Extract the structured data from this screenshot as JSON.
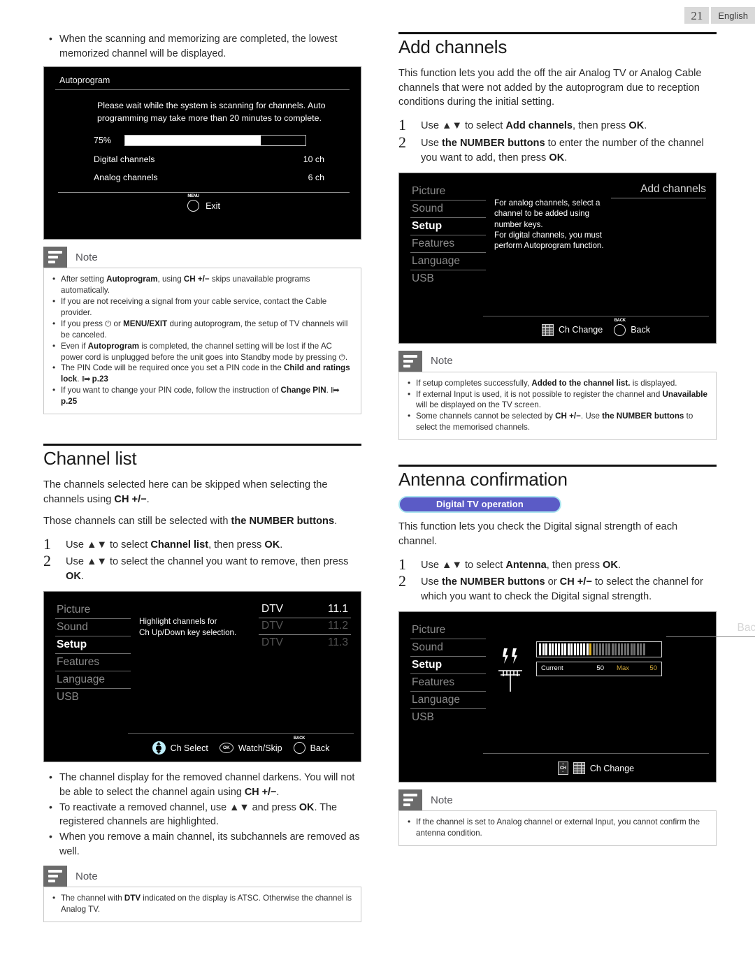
{
  "header": {
    "page_number": "21",
    "language": "English"
  },
  "left_column": {
    "intro_bullets": [
      "When the scanning and memorizing are completed, the lowest memorized channel will be displayed."
    ],
    "autoprogram_screen": {
      "title": "Autoprogram",
      "message": "Please wait while the system is scanning for channels. Auto programming may take more than 20 minutes to complete.",
      "progress_percent": "75%",
      "progress_value": 75,
      "rows": [
        {
          "label": "Digital channels",
          "value": "10 ch"
        },
        {
          "label": "Analog channels",
          "value": "6 ch"
        }
      ],
      "footer_button_cap": "MENU",
      "footer_button_label": "Exit"
    },
    "note1": {
      "label": "Note",
      "items": [
        "After setting <b>Autoprogram</b>, using <b>CH +/−</b> skips unavailable programs automatically.",
        "If you are not receiving a signal from your cable service, contact the Cable provider.",
        "If you press ⏻ or <b>MENU/EXIT</b> during autoprogram, the setup of TV channels will be canceled.",
        "Even if <b>Autoprogram</b> is completed, the channel setting will be lost if the AC power cord is unplugged before the unit goes into Standby mode by pressing ⏻.",
        "The PIN Code will be required once you set a PIN code in the <b>Child and ratings lock</b>. <span class='arrow-ref'>‖➡</span> <b>p.23</b>",
        "If you want to change your PIN code, follow the instruction of <b>Change PIN</b>. <span class='arrow-ref'>‖➡</span> <b>p.25</b>"
      ]
    },
    "channel_list_section": {
      "title": "Channel list",
      "paragraphs": [
        "The channels selected here can be skipped when selecting the channels using <b>CH +/−</b>.",
        "Those channels can still be selected with <b>the NUMBER buttons</b>."
      ],
      "steps": [
        {
          "num": "1",
          "text": "Use ▲▼ to select <b>Channel list</b>, then press <b>OK</b>."
        },
        {
          "num": "2",
          "text": "Use ▲▼ to select the channel you want to remove, then press <b>OK</b>."
        }
      ],
      "tv_menu": {
        "menu_items": [
          "Picture",
          "Sound",
          "Setup",
          "Features",
          "Language",
          "USB"
        ],
        "selected_item": "Setup",
        "middle_text": "Highlight channels for\nCh Up/Down key selection.",
        "channels": [
          {
            "type": "DTV",
            "number": "11.1",
            "state": "bright"
          },
          {
            "type": "DTV",
            "number": "11.2",
            "state": "dim"
          },
          {
            "type": "DTV",
            "number": "11.3",
            "state": "dim"
          }
        ],
        "footer": [
          {
            "icon": "dpad-icon",
            "label": "Ch Select"
          },
          {
            "icon": "ok-button-icon",
            "label": "Watch/Skip"
          },
          {
            "icon": "back-button-icon",
            "cap": "BACK",
            "label": "Back"
          }
        ]
      },
      "after_bullets": [
        "The channel display for the removed channel darkens. You will not be able to select the channel again using <b>CH +/−</b>.",
        "To reactivate a removed channel, use ▲▼ and press <b>OK</b>. The registered channels are highlighted.",
        "When you remove a main channel, its subchannels are removed as well."
      ],
      "note": {
        "label": "Note",
        "items": [
          "The channel with <b>DTV</b> indicated on the display is ATSC. Otherwise the channel is Analog TV."
        ]
      }
    }
  },
  "right_column": {
    "add_channels_section": {
      "title": "Add channels",
      "paragraph": "This function lets you add the off the air Analog TV or Analog Cable channels that were not added by the autoprogram due to reception conditions during the initial setting.",
      "steps": [
        {
          "num": "1",
          "text": "Use ▲▼ to select <b>Add channels</b>, then press <b>OK</b>."
        },
        {
          "num": "2",
          "text": "Use <b>the NUMBER buttons</b> to enter the number of the channel you want to add, then press <b>OK</b>."
        }
      ],
      "tv_menu": {
        "menu_items": [
          "Picture",
          "Sound",
          "Setup",
          "Features",
          "Language",
          "USB"
        ],
        "selected_item": "Setup",
        "middle_text": "For analog channels, select a channel to be added using number keys.\nFor digital channels, you must perform Autoprogram function.",
        "right_header": "Add channels",
        "footer": [
          {
            "icon": "keypad-icon",
            "label": "Ch Change"
          },
          {
            "icon": "back-button-icon",
            "cap": "BACK",
            "label": "Back"
          }
        ]
      },
      "note": {
        "label": "Note",
        "items": [
          "If setup completes successfully, <b>Added to the channel list.</b> is displayed.",
          "If external Input is used, it is not possible to register the channel and <b>Unavailable</b> will be displayed on the TV screen.",
          "Some channels cannot be selected by <b>CH +/−</b>. Use <b>the NUMBER buttons</b> to select the memorised channels."
        ]
      }
    },
    "antenna_section": {
      "title": "Antenna confirmation",
      "badge": "Digital TV operation",
      "badge_color": "#5b5bc6",
      "paragraph": "This function lets you check the Digital signal strength of each channel.",
      "steps": [
        {
          "num": "1",
          "text": "Use ▲▼ to select <b>Antenna</b>, then press <b>OK</b>."
        },
        {
          "num": "2",
          "text": "Use <b>the NUMBER buttons</b> or <b>CH +/−</b> to select the channel for which you want to check the Digital signal strength."
        }
      ],
      "tv_menu": {
        "menu_items": [
          "Picture",
          "Sound",
          "Setup",
          "Features",
          "Language",
          "USB"
        ],
        "selected_item": "Setup",
        "right_header": "Back",
        "signal": {
          "current_label": "Current",
          "current_value": "50",
          "max_label": "Max",
          "max_value": "50",
          "filled_segments": 17,
          "total_segments": 34,
          "marker_color": "#e0b020"
        },
        "footer": [
          {
            "icon": "ch-updown-button-icon",
            "label": ""
          },
          {
            "icon": "keypad-icon",
            "label": "Ch Change"
          }
        ]
      },
      "note": {
        "label": "Note",
        "items": [
          "If the channel is set to Analog channel or external Input, you cannot confirm the antenna condition."
        ]
      }
    }
  }
}
